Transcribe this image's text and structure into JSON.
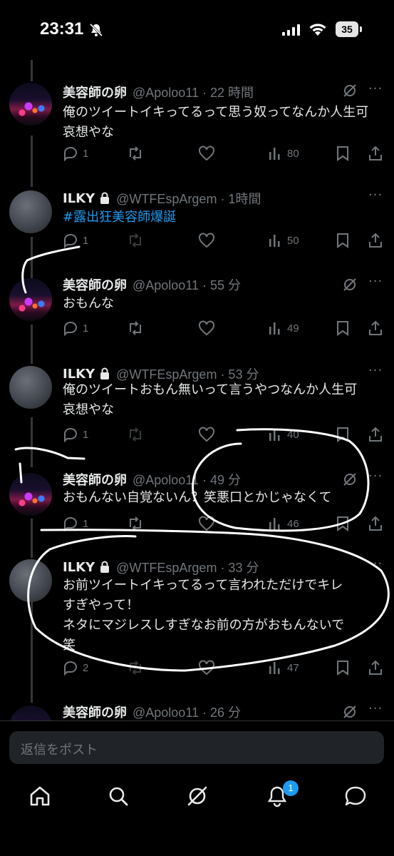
{
  "status_bar": {
    "time": "23:31",
    "battery": "35"
  },
  "tweets": [
    {
      "name": "美容師の卵",
      "handle": "@Apoloo11 · 22 時間",
      "text": "俺のツイートイキってるって思う奴ってなんか人生可哀想やな",
      "replies": "1",
      "views": "80"
    },
    {
      "name": "ILKY",
      "handle": "@WTFEspArgem · 1時間",
      "text": "#露出狂美容師爆誕",
      "replies": "1",
      "views": "50"
    },
    {
      "name": "美容師の卵",
      "handle": "@Apoloo11 · 55 分",
      "text": "おもんな",
      "replies": "1",
      "views": "49"
    },
    {
      "name": "ILKY",
      "handle": "@WTFEspArgem · 53 分",
      "text": "俺のツイートおもん無いって言うやつなんか人生可哀想やな",
      "replies": "1",
      "views": "40"
    },
    {
      "name": "美容師の卵",
      "handle": "@Apoloo11 · 49 分",
      "text": "おもんない自覚ないん？笑悪口とかじゃなくて",
      "replies": "1",
      "views": "46"
    },
    {
      "name": "ILKY",
      "handle": "@WTFEspArgem · 33 分",
      "text_lines": [
        "お前ツイートイキってるって言われただけでキレ",
        "すぎやって！",
        "ネタにマジレスしすぎなお前の方がおもんないで",
        "笑"
      ],
      "replies": "2",
      "views": "47"
    },
    {
      "name": "美容師の卵",
      "handle": "@Apoloo11 · 26 分"
    }
  ],
  "reply_box": {
    "placeholder": "返信をポスト"
  },
  "tab_bar": {
    "notifications_badge": "1"
  },
  "colors": {
    "accent": "#1d9bf0",
    "muted": "#71767b",
    "text": "#e7e9ea",
    "background": "#000000"
  }
}
